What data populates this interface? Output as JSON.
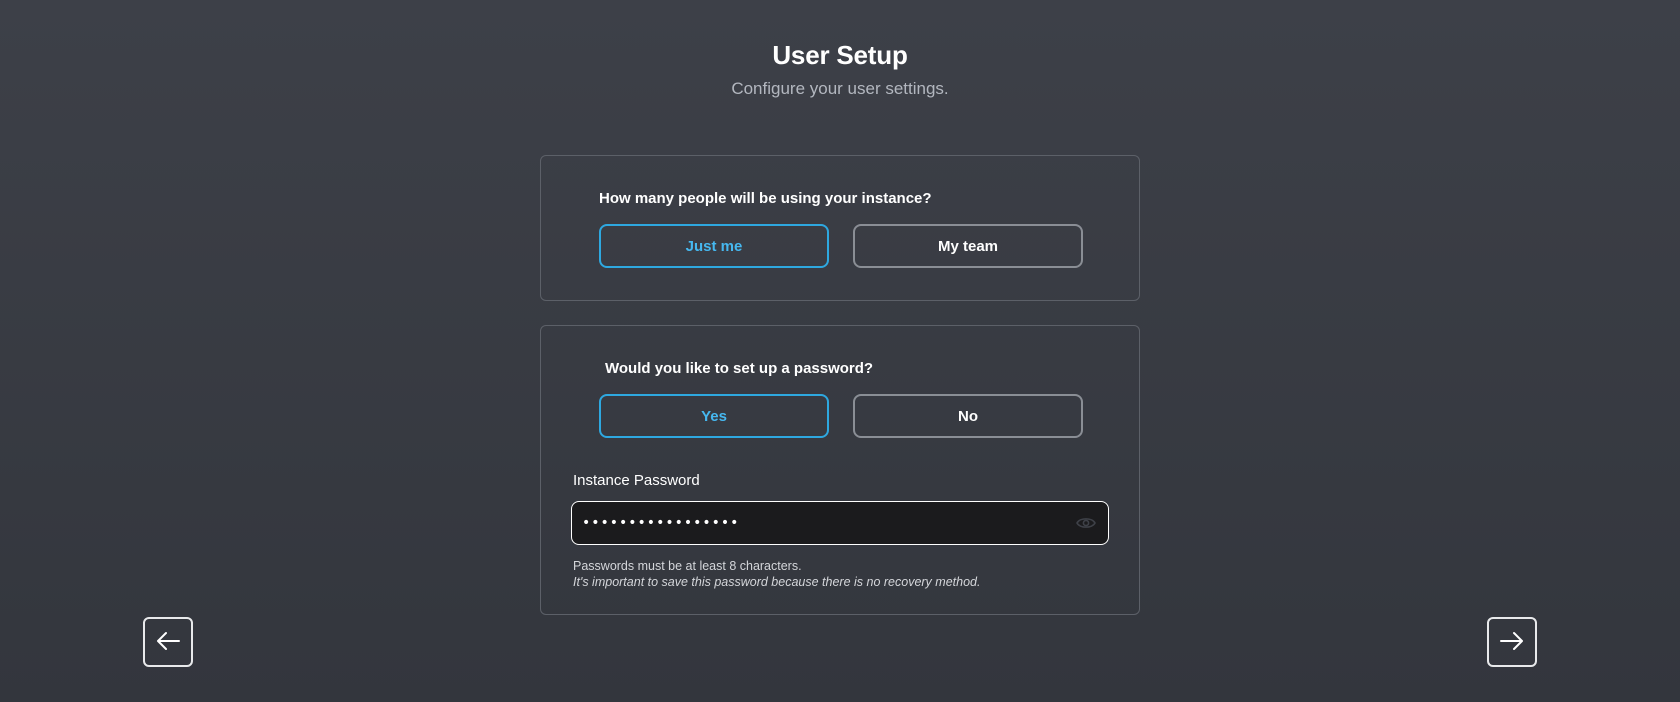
{
  "header": {
    "title": "User Setup",
    "subtitle": "Configure your user settings."
  },
  "users_question": {
    "label": "How many people will be using your instance?",
    "options": [
      {
        "label": "Just me",
        "selected": true
      },
      {
        "label": "My team",
        "selected": false
      }
    ]
  },
  "password_question": {
    "label": "Would you like to set up a password?",
    "options": [
      {
        "label": "Yes",
        "selected": true
      },
      {
        "label": "No",
        "selected": false
      }
    ],
    "field_label": "Instance Password",
    "masked_value": "•••••••••••••••••",
    "hint_min_length": "Passwords must be at least 8 characters.",
    "hint_recovery": "It's important to save this password because there is no recovery method."
  },
  "navigation": {
    "back_icon": "arrow-left-icon",
    "next_icon": "arrow-right-icon"
  },
  "colors": {
    "accent": "#2ea8e0",
    "accent_text": "#46b8f0",
    "background": "#3a3d45",
    "input_bg": "#1b1b1d"
  }
}
